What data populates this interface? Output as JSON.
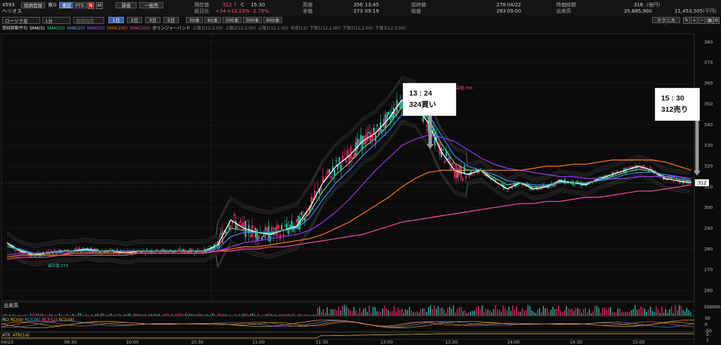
{
  "header": {
    "code": "4593",
    "name": "ヘリオス",
    "buttons": [
      "銘柄登録",
      "東G"
    ],
    "market_tabs": [
      "東証",
      "PTS"
    ],
    "extra_icons": [
      "N",
      "M"
    ],
    "mode_buttons": [
      "貸借",
      "一般売"
    ],
    "current_price_label": "現在値",
    "current_price": "312",
    "current_price_flag": "C",
    "current_time": "15:30",
    "change_label": "前日比",
    "change": "+34",
    "change_pct": "+12.23%",
    "change_pct2": "-2.79%",
    "high_label": "高値",
    "high": "356",
    "high_time": "13:45",
    "low_label": "安値",
    "low": "273",
    "low_time": "09:19",
    "prev_close_label": "前終値",
    "prev_close": "278",
    "prev_close_date": "04/22",
    "open_label": "始値",
    "open": "283",
    "open_time": "09:00",
    "market_cap_label": "時価総額",
    "market_cap": "316",
    "market_cap_unit": "(億円)",
    "volume_label": "出来高",
    "volume": "35,685,900",
    "turnover": "11,453,505",
    "turnover_unit": "(千円)"
  },
  "toolbar": {
    "chart_type": "ローソク足",
    "interval": "1分",
    "period_placeholder": "期間指定",
    "ranges": [
      "1日",
      "2日",
      "3日",
      "5日"
    ],
    "counts": [
      "30本",
      "60本",
      "100本",
      "300本",
      "600本"
    ],
    "technical": "テクニカル",
    "icons": [
      "pencil-icon",
      "zoom-in-icon",
      "zoom-out-icon",
      "grid-icon",
      "settings-icon"
    ]
  },
  "indicator_bar": {
    "items": [
      {
        "label": "単純移動平均",
        "color": "#dddddd"
      },
      {
        "label": "SMA(5)",
        "color": "#ffffff"
      },
      {
        "label": "SMA(10)",
        "color": "#4ade80"
      },
      {
        "label": "SMA(20)",
        "color": "#60a5fa"
      },
      {
        "label": "SMA(50)",
        "color": "#a855f7"
      },
      {
        "label": "SMA(100)",
        "color": "#f97316"
      },
      {
        "label": "SMA(200)",
        "color": "#ec4899"
      },
      {
        "label": "ボリンジャーバンド",
        "color": "#dddddd"
      },
      {
        "label": "上限3(12,3.00)",
        "color": "#8a8a8a"
      },
      {
        "label": "上限2(12,2.00)",
        "color": "#8a8a8a"
      },
      {
        "label": "上限1(12,1.00)",
        "color": "#8a8a8a"
      },
      {
        "label": "中央(12)",
        "color": "#8a8a8a"
      },
      {
        "label": "下限1(12,1.00)",
        "color": "#8a8a8a"
      },
      {
        "label": "下限2(12,2.00)",
        "color": "#8a8a8a"
      },
      {
        "label": "下限3(12,3.00)",
        "color": "#8a8a8a"
      }
    ]
  },
  "annotations": {
    "buy_time": "13 : 24",
    "buy_text": "324買い",
    "sell_time": "15 : 30",
    "sell_text": "312売り",
    "high_marker": "高値:356",
    "low_marker": "最安値:273",
    "price_tag": "312"
  },
  "subpanels": {
    "volume_label": "出来高",
    "volume_scale": "500000",
    "rci_labels": [
      {
        "label": "RCI",
        "color": "#dddddd"
      },
      {
        "label": "RCI(9)",
        "color": "#f5c542"
      },
      {
        "label": "RCI(26)",
        "color": "#4da3ff"
      },
      {
        "label": "RCI(52)",
        "color": "#ff6b6b"
      },
      {
        "label": "RCI(48)",
        "color": "#f59e0b"
      }
    ],
    "rci_scale": [
      "50",
      "0",
      "-50"
    ],
    "atr_label": "ATR",
    "atr_param": "ATR(14)",
    "atr_scale": [
      "5",
      "1"
    ]
  },
  "colors": {
    "up": "#ff2b6a",
    "down": "#2dd4bf",
    "sma5": "#ffffff",
    "sma10": "#4ade80",
    "sma20": "#3b82f6",
    "sma50": "#9333ea",
    "sma100": "#f97316",
    "sma200": "#ec4899",
    "bollinger": "#6b6b6b"
  },
  "chart_data": {
    "type": "line",
    "title": "",
    "y_ticks": [
      260,
      270,
      280,
      290,
      300,
      310,
      320,
      330,
      340,
      350,
      360,
      370,
      380
    ],
    "x_ticks": [
      "04/23",
      "09:30",
      "10:00",
      "10:30",
      "11:00",
      "11:30",
      "13:00",
      "13:30",
      "14:00",
      "14:30",
      "15:00"
    ],
    "ylim": [
      255,
      384
    ],
    "x": [
      "09:00",
      "09:10",
      "09:20",
      "09:30",
      "09:40",
      "09:50",
      "10:00",
      "10:10",
      "10:20",
      "10:30",
      "10:40",
      "10:50",
      "11:00",
      "11:10",
      "11:20",
      "11:30",
      "12:30",
      "12:35",
      "12:40",
      "12:45",
      "12:50",
      "12:55",
      "13:00",
      "13:05",
      "13:10",
      "13:15",
      "13:20",
      "13:24",
      "13:30",
      "13:35",
      "13:40",
      "13:45",
      "13:50",
      "13:55",
      "14:00",
      "14:05",
      "14:10",
      "14:15",
      "14:20",
      "14:25",
      "14:30",
      "14:35",
      "14:40",
      "14:45",
      "14:50",
      "14:55",
      "15:00",
      "15:05",
      "15:10",
      "15:15",
      "15:20",
      "15:25",
      "15:30"
    ],
    "series": [
      {
        "name": "SMA(5)",
        "values": [
          283,
          279,
          277,
          278,
          279,
          279,
          280,
          279,
          279,
          278,
          279,
          279,
          279,
          279,
          279,
          279,
          282,
          294,
          290,
          288,
          287,
          289,
          291,
          300,
          312,
          320,
          325,
          332,
          336,
          343,
          352,
          350,
          341,
          327,
          318,
          316,
          318,
          313,
          309,
          312,
          309,
          310,
          313,
          312,
          311,
          314,
          316,
          318,
          320,
          318,
          314,
          313,
          312
        ]
      },
      {
        "name": "SMA(20)",
        "values": [
          281,
          280,
          278,
          278,
          279,
          279,
          279,
          279,
          279,
          279,
          279,
          279,
          279,
          279,
          279,
          279,
          280,
          286,
          288,
          288,
          288,
          289,
          290,
          295,
          304,
          312,
          318,
          325,
          331,
          337,
          345,
          349,
          345,
          335,
          325,
          320,
          318,
          316,
          313,
          312,
          311,
          311,
          312,
          312,
          312,
          313,
          314,
          316,
          317,
          317,
          316,
          315,
          313
        ]
      },
      {
        "name": "SMA(50)",
        "values": [
          277,
          278,
          278,
          278,
          278,
          278,
          278,
          279,
          279,
          279,
          279,
          279,
          279,
          279,
          279,
          279,
          279,
          281,
          283,
          284,
          285,
          286,
          287,
          289,
          293,
          298,
          304,
          311,
          318,
          324,
          330,
          333,
          335,
          334,
          332,
          328,
          324,
          321,
          319,
          318,
          317,
          316,
          315,
          315,
          314,
          314,
          314,
          314,
          315,
          315,
          315,
          315,
          314
        ]
      },
      {
        "name": "SMA(100)",
        "values": [
          276,
          277,
          277,
          277,
          277,
          278,
          278,
          278,
          278,
          278,
          278,
          278,
          278,
          278,
          278,
          278,
          279,
          280,
          281,
          281,
          282,
          283,
          284,
          285,
          287,
          290,
          293,
          297,
          301,
          305,
          310,
          314,
          317,
          318,
          318,
          318,
          318,
          318,
          318,
          318,
          319,
          320,
          320,
          321,
          321,
          322,
          323,
          323,
          323,
          323,
          322,
          320,
          318
        ]
      },
      {
        "name": "SMA(200)",
        "values": [
          275,
          276,
          276,
          276,
          277,
          277,
          277,
          277,
          277,
          277,
          278,
          278,
          278,
          278,
          278,
          278,
          279,
          279,
          280,
          280,
          281,
          281,
          282,
          283,
          284,
          285,
          286,
          287,
          289,
          291,
          293,
          294,
          295,
          296,
          297,
          298,
          299,
          300,
          301,
          302,
          302,
          303,
          303,
          304,
          305,
          305,
          306,
          307,
          308,
          308,
          309,
          310,
          311
        ]
      }
    ]
  }
}
